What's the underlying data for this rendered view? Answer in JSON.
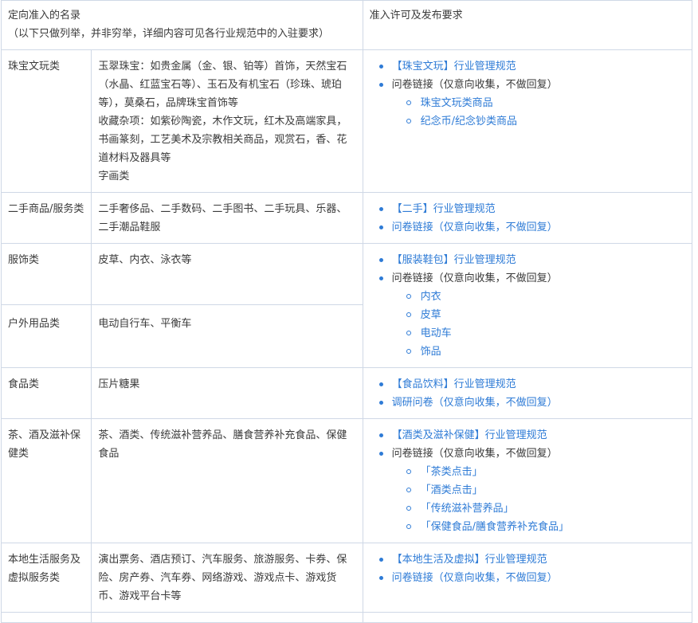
{
  "header": {
    "col1_title": "定向准入的名录",
    "col1_note": "（以下只做列举，并非穷举，详细内容可见各行业规范中的入驻要求）",
    "col2_title": "准入许可及发布要求"
  },
  "rows": [
    {
      "category": "珠宝文玩类",
      "items": [
        "玉翠珠宝：如贵金属（金、银、铂等）首饰，天然宝石（水晶、红蓝宝石等）、玉石及有机宝石（珍珠、琥珀等），莫桑石，品牌珠宝首饰等",
        "收藏杂项：如紫砂陶瓷，木作文玩，红木及高端家具，书画篆刻，工艺美术及宗教相关商品，观赏石，香、花道材料及器具等",
        "字画类"
      ],
      "links": [
        {
          "text": "【珠宝文玩】行业管理规范",
          "sub": []
        },
        {
          "text": "问卷链接（仅意向收集，不做回复）",
          "sub": [
            "珠宝文玩类商品",
            "纪念币/纪念钞类商品"
          ]
        }
      ]
    },
    {
      "category": "二手商品/服务类",
      "items": [
        "二手奢侈品、二手数码、二手图书、二手玩具、乐器、二手潮品鞋服"
      ],
      "links": [
        {
          "text": "【二手】行业管理规范",
          "sub": []
        },
        {
          "text": "问卷链接（仅意向收集，不做回复）",
          "sub": []
        }
      ]
    },
    {
      "category": "服饰类",
      "items": [
        "皮草、内衣、泳衣等"
      ],
      "links": [
        {
          "text": "【服装鞋包】行业管理规范",
          "sub": []
        },
        {
          "text": "问卷链接（仅意向收集，不做回复）",
          "sub": [
            "内衣",
            "皮草",
            "电动车",
            "饰品"
          ]
        }
      ]
    },
    {
      "category": "户外用品类",
      "items": [
        "电动自行车、平衡车"
      ]
    },
    {
      "category": "食品类",
      "items": [
        "压片糖果"
      ],
      "links": [
        {
          "text": "【食品饮料】行业管理规范",
          "sub": []
        },
        {
          "text": "调研问卷（仅意向收集，不做回复）",
          "sub": []
        }
      ]
    },
    {
      "category": "茶、酒及滋补保健类",
      "items": [
        "茶、酒类、传统滋补营养品、膳食营养补充食品、保健食品"
      ],
      "links": [
        {
          "text": "【酒类及滋补保健】行业管理规范",
          "sub": []
        },
        {
          "text": "问卷链接（仅意向收集，不做回复）",
          "sub": [
            "「茶类点击」",
            "「酒类点击」",
            "「传统滋补营养品」",
            "「保健食品/膳食营养补充食品」"
          ]
        }
      ]
    },
    {
      "category": "本地生活服务及虚拟服务类",
      "items": [
        "演出票务、酒店预订、汽车服务、旅游服务、卡券、保险、房产券、汽车券、网络游戏、游戏点卡、游戏货币、游戏平台卡等"
      ],
      "links": [
        {
          "text": "【本地生活及虚拟】行业管理规范",
          "sub": []
        },
        {
          "text": "问卷链接（仅意向收集，不做回复）",
          "sub": []
        }
      ]
    }
  ],
  "colors": {
    "link": "#2e7bd6",
    "border": "#cfd8e6",
    "text": "#3a3a3a"
  }
}
